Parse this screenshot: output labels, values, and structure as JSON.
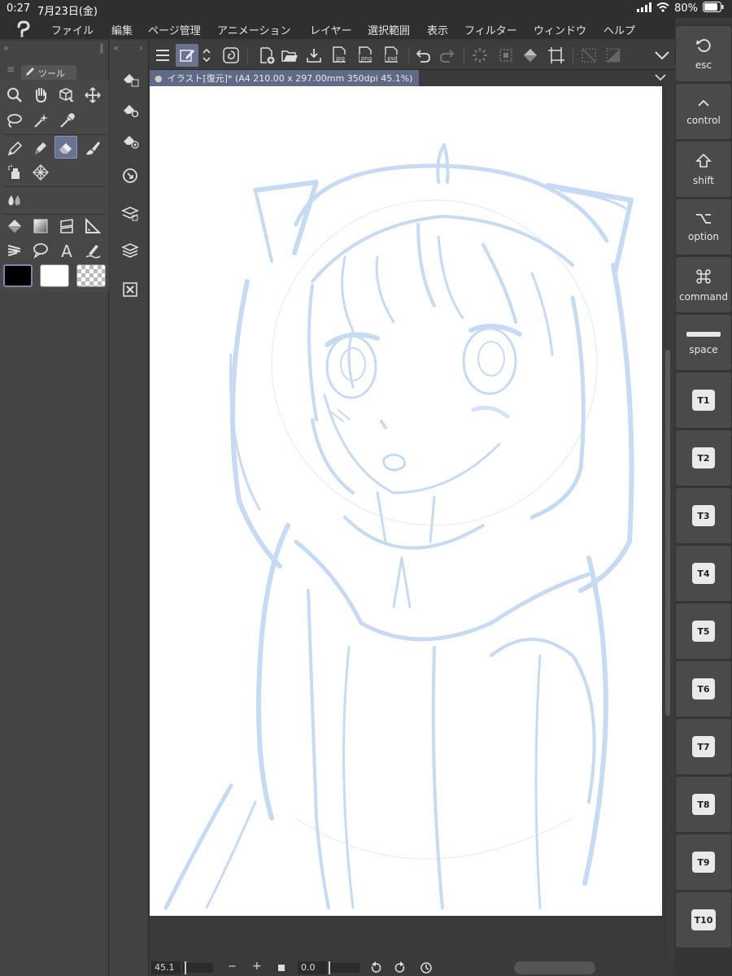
{
  "status": {
    "time": "0:27",
    "date": "7月23日(金)",
    "battery": "80%"
  },
  "menu": {
    "items": [
      "ファイル",
      "編集",
      "ページ管理",
      "アニメーション",
      "レイヤー",
      "選択範囲",
      "表示",
      "フィルター",
      "ウィンドウ",
      "ヘルプ"
    ]
  },
  "tools": {
    "tab_label": "ツール",
    "selected": "eraser-tool",
    "main_color": "#000000",
    "sub_color": "#ffffff"
  },
  "canvas": {
    "tab_title": "イラスト[復元]* (A4 210.00 x 297.00mm 350dpi 45.1%)",
    "sketch_color": "#c9dcf5"
  },
  "bottom": {
    "zoom": "45.1",
    "rotation": "0.0",
    "minus": "−",
    "plus": "+"
  },
  "keys": [
    {
      "label": "esc",
      "icon": "undo-arrow-icon"
    },
    {
      "label": "control",
      "icon": "caret-up-icon"
    },
    {
      "label": "shift",
      "icon": "shift-arrow-icon"
    },
    {
      "label": "option",
      "icon": "option-key-icon"
    },
    {
      "label": "command",
      "icon": "command-key-icon"
    },
    {
      "label": "space",
      "icon": "space-bar-icon"
    }
  ],
  "tkeys": [
    "T1",
    "T2",
    "T3",
    "T4",
    "T5",
    "T6",
    "T7",
    "T8",
    "T9",
    "T10"
  ],
  "cmd_icons": {
    "png_label": "png",
    "jpg_label": "jpg",
    "psd_label": "psd"
  }
}
